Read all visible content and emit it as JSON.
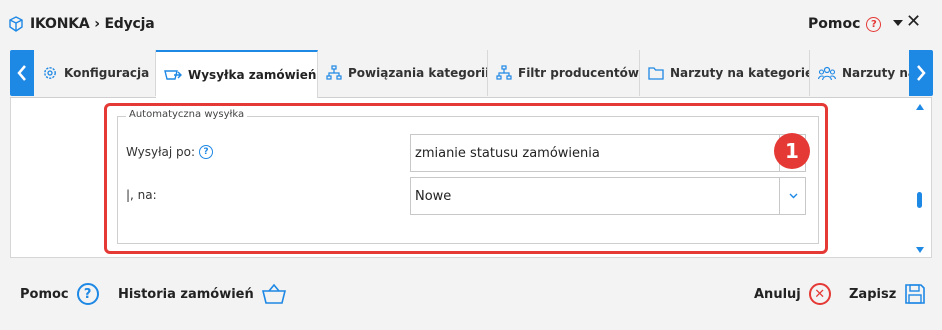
{
  "window": {
    "title": "IKONKA › Edycja",
    "help_label": "Pomoc",
    "help_glyph": "?"
  },
  "tabs": [
    {
      "label": "Konfiguracja",
      "icon": "gear-icon"
    },
    {
      "label": "Wysyłka zamówień",
      "icon": "cart-send-icon",
      "active": true
    },
    {
      "label": "Powiązania kategorii",
      "icon": "hierarchy-icon"
    },
    {
      "label": "Filtr producentów",
      "icon": "filter-icon"
    },
    {
      "label": "Narzuty na kategorie",
      "icon": "folder-icon"
    },
    {
      "label": "Narzuty na p",
      "icon": "people-icon"
    }
  ],
  "fieldset": {
    "legend": "Automatyczna wysyłka",
    "send_after_label": "Wysyłaj po:",
    "send_after_help": "?",
    "send_after_value": "zmianie statusu zamówienia",
    "to_label": "|, na:",
    "to_value": "Nowe"
  },
  "annotation": {
    "badge": "1"
  },
  "footer": {
    "help_label": "Pomoc",
    "help_glyph": "?",
    "history_label": "Historia zamówień",
    "cancel_label": "Anuluj",
    "save_label": "Zapisz"
  },
  "colors": {
    "accent": "#1e88e5",
    "alert": "#e53935"
  }
}
